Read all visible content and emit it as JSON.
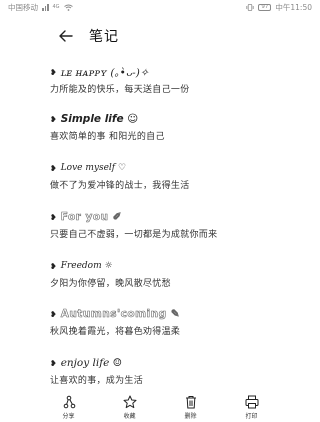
{
  "status_bar": {
    "carrier": "中国移动",
    "network": "4G",
    "battery": "97",
    "time": "中午11:50"
  },
  "header": {
    "title": "笔记"
  },
  "notes": [
    {
      "head": "ʟᴇ ʜᴀᴘᴘʏ (｡•̀ᴗ-)✧",
      "style": "italic",
      "body": "力所能及的快乐，每天送自己一份"
    },
    {
      "head": "Simple life ☺",
      "style": "bold",
      "body": "喜欢简单的事 和阳光的自己"
    },
    {
      "head": "Love myself ♡",
      "style": "script",
      "body": "做不了为爱冲锋的战士，我得生活"
    },
    {
      "head": "For you ✐",
      "style": "outline",
      "body": "只要自己不虚弱，一切都是为成就你而来"
    },
    {
      "head": "Freedom ☼",
      "style": "script",
      "body": "夕阳为你停留，晚风散尽忧愁"
    },
    {
      "head": "Autumns'coming ✎",
      "style": "outline",
      "body": "秋风挽着霞光，将暮色劝得温柔"
    },
    {
      "head": "enjoy life ☺",
      "style": "italic",
      "body": "让喜欢的事，成为生活"
    }
  ],
  "toolbar": {
    "share": "分享",
    "favorite": "收藏",
    "delete": "删除",
    "print": "打印"
  }
}
